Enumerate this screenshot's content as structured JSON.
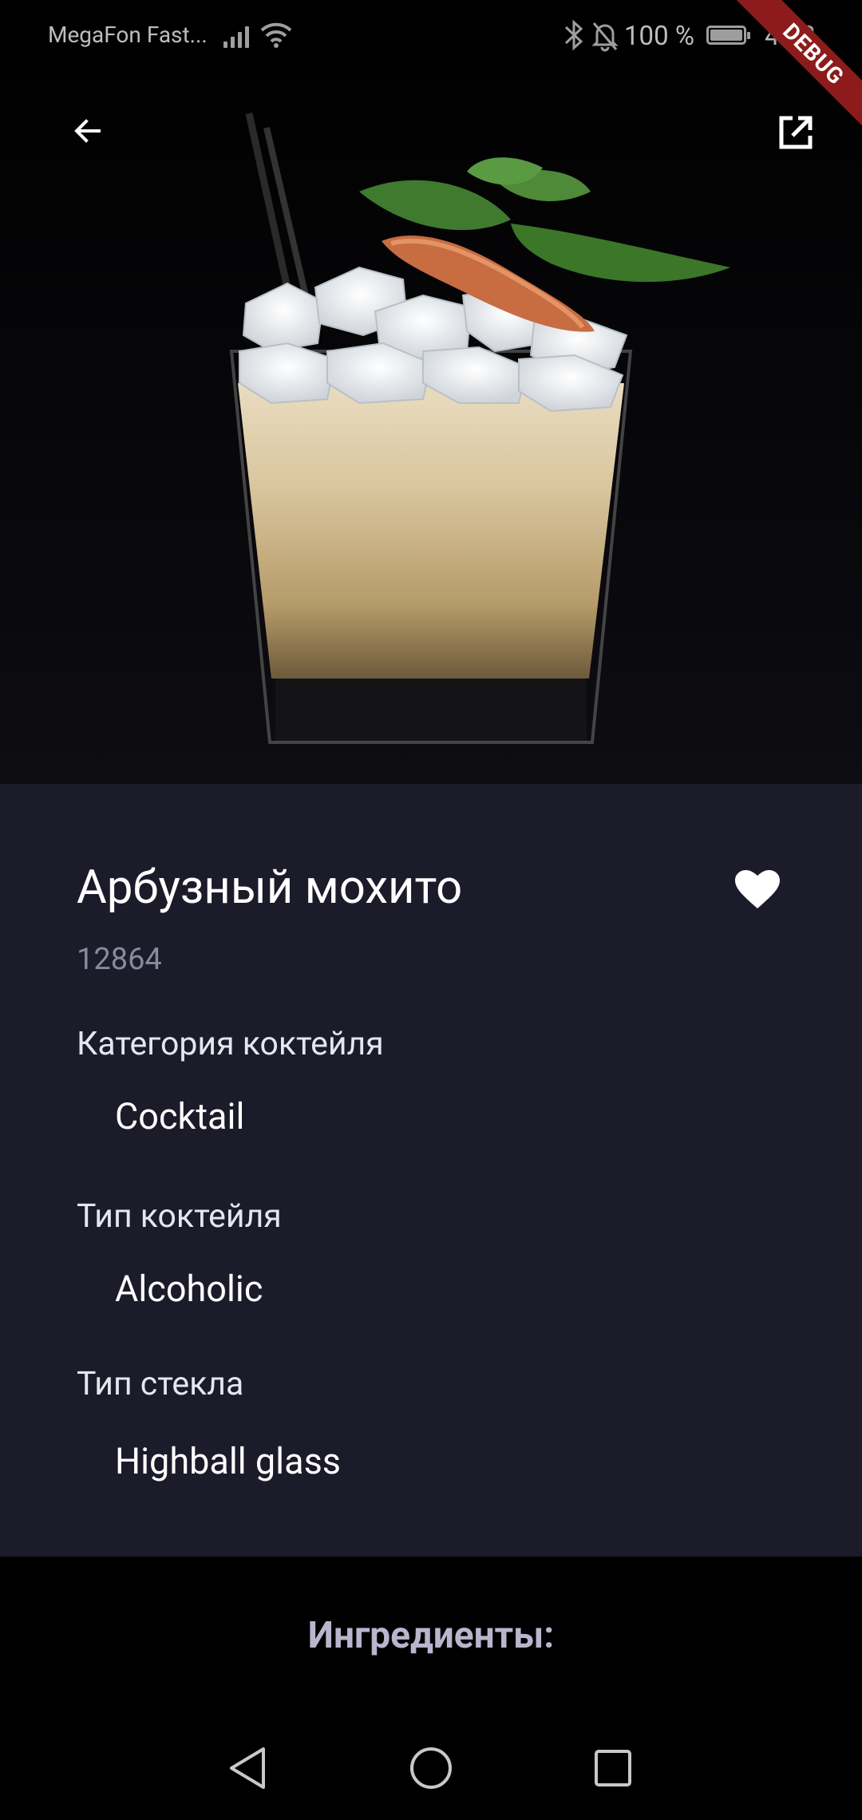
{
  "status_bar": {
    "carrier": "MegaFon Fast...",
    "battery": "100 %",
    "time": "4:52"
  },
  "debug_banner": "DEBUG",
  "drink": {
    "title": "Арбузный мохито",
    "id": "12864",
    "favorite": true,
    "fields": [
      {
        "label": "Категория коктейля",
        "value": "Cocktail"
      },
      {
        "label": "Тип коктейля",
        "value": "Alcoholic"
      },
      {
        "label": "Тип стекла",
        "value": "Highball glass"
      }
    ]
  },
  "ingredients": {
    "heading": "Ингредиенты:"
  },
  "colors": {
    "card_background": "#1b1b2a",
    "page_background": "#000000",
    "ingredients_heading": "#b7b6cd",
    "debug_ribbon": "#8e1b1b"
  },
  "icons": {
    "back": "arrow-left-icon",
    "open_external": "open-in-new-icon",
    "favorite": "heart-filled-icon",
    "nav_back": "triangle-back-icon",
    "nav_home": "circle-home-icon",
    "nav_recents": "square-recents-icon"
  }
}
